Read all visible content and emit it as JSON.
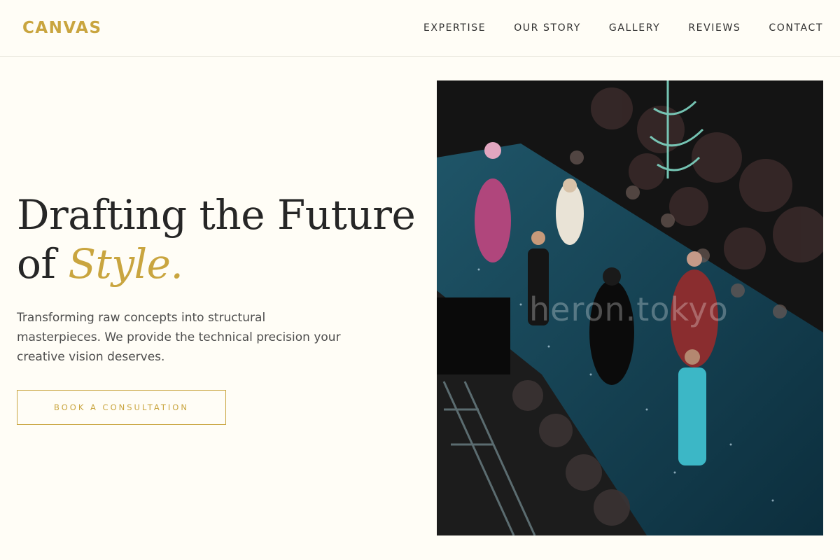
{
  "header": {
    "logo": "CANVAS",
    "nav": {
      "expertise": "EXPERTISE",
      "our_story": "OUR STORY",
      "gallery": "GALLERY",
      "reviews": "REVIEWS",
      "contact": "CONTACT"
    }
  },
  "hero": {
    "title_line1": "Drafting the Future",
    "title_line2_prefix": "of ",
    "title_accent": "Style.",
    "subtitle": "Transforming raw concepts into structural masterpieces. We provide the technical precision your creative vision deserves.",
    "cta_label": "BOOK A CONSULTATION",
    "image": {
      "watermark": "heron.tokyo"
    }
  },
  "colors": {
    "background": "#fffdf6",
    "accent": "#c9a53f",
    "text": "#262626",
    "runway": "#0f3a4c"
  }
}
